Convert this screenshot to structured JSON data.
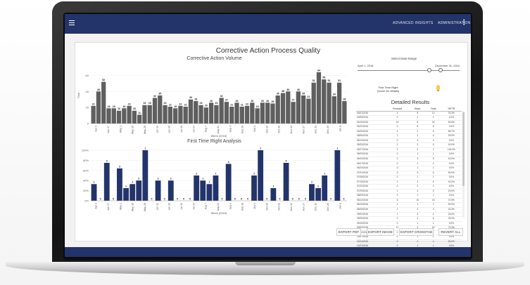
{
  "topbar": {
    "menu_icon": "hamburger-icon",
    "nav": [
      "ADVANCED INSIGHTS",
      "ADMINISTRATION"
    ],
    "more_icon": "vertical-ellipsis-icon"
  },
  "page": {
    "title": "Corrective Action Process Quality"
  },
  "colors": {
    "appbar": "#22346a",
    "bar_gray": "#5f5f5f",
    "bar_navy": "#22346a",
    "bulb": "#f2c94c"
  },
  "filters": {
    "date_range_label": "Select Date Range",
    "start_date": "April 1, 2016",
    "end_date": "December 31, 2016",
    "ftr_label": "First Time Right",
    "ftr_hint": "(hover for details)",
    "ftr_icon": "lightbulb-icon"
  },
  "details": {
    "title": "Detailed Results",
    "columns": [
      "",
      "Forward",
      "Back",
      "Total",
      "%FTR"
    ],
    "rows": [
      [
        "04/01/2016",
        "4",
        "8",
        "12",
        "33.3%"
      ],
      [
        "04/08/2016",
        "0",
        "2",
        "2",
        "0.0%"
      ],
      [
        "04/15/2016",
        "14",
        "8",
        "22",
        "63.6%"
      ],
      [
        "04/22/2016",
        "0",
        "8",
        "8",
        "0.0%"
      ],
      [
        "04/29/2016",
        "4",
        "2",
        "6",
        "66.7%"
      ],
      [
        "05/06/2016",
        "1",
        "3",
        "4",
        "25.0%"
      ],
      [
        "05/13/2016",
        "0",
        "4",
        "4",
        "0.0%"
      ],
      [
        "05/20/2016",
        "2",
        "3",
        "5",
        "40.0%"
      ],
      [
        "05/27/2016",
        "2",
        "0",
        "2",
        "100.0%"
      ],
      [
        "06/03/2016",
        "0",
        "1",
        "1",
        "0.0%"
      ],
      [
        "06/10/2016",
        "2",
        "3",
        "5",
        "40.0%"
      ],
      [
        "06/17/2016",
        "0",
        "2",
        "2",
        "0.0%"
      ],
      [
        "06/24/2016",
        "0",
        "1",
        "1",
        "0.0%"
      ],
      [
        "07/01/2016",
        "3",
        "3",
        "6",
        "50.0%"
      ],
      [
        "07/08/2016",
        "0",
        "1",
        "1",
        "0.0%"
      ],
      [
        "07/15/2016",
        "2",
        "3",
        "5",
        "40.0%"
      ],
      [
        "07/22/2016",
        "0",
        "2",
        "2",
        "0.0%"
      ],
      [
        "07/29/2016",
        "1",
        "4",
        "5",
        "20.0%"
      ],
      [
        "08/05/2016",
        "0",
        "1",
        "1",
        "0.0%"
      ],
      [
        "08/12/2016",
        "6",
        "10",
        "16",
        "37.5%"
      ],
      [
        "08/19/2016",
        "1",
        "1",
        "2",
        "50.0%"
      ],
      [
        "08/26/2016",
        "1",
        "2",
        "3",
        "33.3%"
      ],
      [
        "09/02/2016",
        "1",
        "3",
        "4",
        "25.0%"
      ],
      [
        "09/09/2016",
        "2",
        "4",
        "6",
        "33.3%"
      ],
      [
        "09/16/2016",
        "0",
        "1",
        "1",
        "0.0%"
      ],
      [
        "09/23/2016",
        "11",
        "4",
        "15",
        "73.3%"
      ],
      [
        "09/30/2016",
        "0",
        "1",
        "1",
        "0.0%"
      ],
      [
        "10/07/2016",
        "0",
        "1",
        "1",
        "0.0%"
      ],
      [
        "10/14/2016",
        "2",
        "2",
        "4",
        "50.0%"
      ],
      [
        "10/21/2016",
        "0",
        "1",
        "1",
        "0.0%"
      ]
    ]
  },
  "actions": [
    "EXPORT PDF",
    "EXPORT IMAGE",
    "EXPORT CROSSTAB",
    "REVERT ALL"
  ],
  "chart_data": [
    {
      "type": "bar",
      "title": "Corrective Action Volume",
      "xlabel": "Week (2016)",
      "ylabel": "Total",
      "ylim": [
        0,
        70
      ],
      "yticks": [
        0,
        20,
        40,
        60
      ],
      "color": "#5f5f5f",
      "tick_labels": [
        "Apr 3",
        "Apr 17",
        "May 1",
        "May 15",
        "May 29",
        "Jun 12",
        "Jun 26",
        "Jul 10",
        "Jul 24",
        "Aug 7",
        "Aug 21",
        "Sep 4",
        "Sep 18",
        "Oct 2",
        "Oct 16",
        "Oct 30",
        "Nov 13",
        "Nov 27",
        "Dec 11",
        "Dec 25",
        "Jan 8"
      ],
      "values": [
        22,
        40,
        52,
        19,
        19,
        16,
        19,
        22,
        16,
        11,
        23,
        23,
        32,
        35,
        23,
        21,
        19,
        22,
        21,
        30,
        28,
        23,
        20,
        26,
        23,
        32,
        27,
        21,
        26,
        21,
        22,
        26,
        19,
        26,
        26,
        25,
        35,
        38,
        40,
        27,
        40,
        35,
        31,
        51,
        64,
        55,
        51,
        34,
        51,
        28
      ]
    },
    {
      "type": "bar",
      "title": "First Time Right Analysis",
      "xlabel": "Week (2016)",
      "ylabel": "",
      "ylim": [
        0,
        1.0
      ],
      "yticks": [
        "0%",
        "20%",
        "40%",
        "60%",
        "80%",
        "100%"
      ],
      "color": "#22346a",
      "tick_labels": [
        "Apr 3",
        "Apr 17",
        "May 1",
        "May 15",
        "May 29",
        "Jun 12",
        "Jun 26",
        "Jul 10",
        "Jul 24",
        "Aug 7",
        "Aug 21",
        "Sep 4",
        "Sep 18",
        "Oct 2",
        "Oct 16",
        "Oct 30",
        "Nov 13",
        "Nov 27",
        "Dec 11",
        "Dec 25",
        "Jan 8"
      ],
      "values": [
        0.33,
        0,
        0.75,
        0,
        0.64,
        0.25,
        0.33,
        0.4,
        1.0,
        0,
        0.4,
        0,
        0.4,
        0,
        0,
        0,
        0.5,
        0.4,
        0.33,
        0.5,
        0,
        0.73,
        0,
        0,
        0,
        0.5,
        1.0,
        0,
        0.25,
        0,
        0.75,
        0,
        0,
        0,
        0.33,
        0.25,
        0.5,
        0,
        1.0,
        0
      ],
      "labels": [
        "1",
        "0",
        "3",
        "0",
        "3",
        "1",
        "1",
        "2",
        "1",
        "0",
        "2",
        "0",
        "2",
        "0",
        "0",
        "0",
        "2",
        "1",
        "1",
        "1",
        "0",
        "3",
        "0",
        "0",
        "0",
        "2",
        "1",
        "0",
        "1",
        "0",
        "4",
        "0",
        "0",
        "0",
        "1",
        "1",
        "1",
        "0",
        "1",
        "0"
      ]
    }
  ]
}
